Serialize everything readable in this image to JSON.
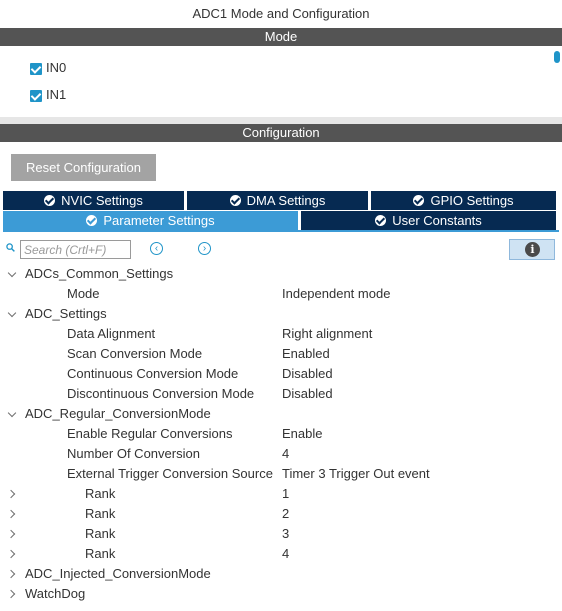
{
  "window": {
    "title": "ADC1 Mode and Configuration"
  },
  "mode": {
    "header": "Mode",
    "channels": [
      {
        "label": "IN0",
        "checked": true
      },
      {
        "label": "IN1",
        "checked": true
      }
    ]
  },
  "configuration": {
    "header": "Configuration",
    "reset_label": "Reset Configuration",
    "tabs": [
      {
        "label": "NVIC Settings",
        "active": false
      },
      {
        "label": "DMA Settings",
        "active": false
      },
      {
        "label": "GPIO Settings",
        "active": false
      },
      {
        "label": "Parameter Settings",
        "active": true
      },
      {
        "label": "User Constants",
        "active": false
      }
    ],
    "search": {
      "placeholder": "Search (Crtl+F)",
      "value": ""
    },
    "nav": {
      "prev": "‹",
      "next": "›"
    },
    "info": "i"
  },
  "tree": [
    {
      "label": "ADCs_Common_Settings",
      "value": "",
      "level": 0,
      "expander": "down"
    },
    {
      "label": "Mode",
      "value": "Independent mode",
      "level": 1,
      "expander": ""
    },
    {
      "label": "ADC_Settings",
      "value": "",
      "level": 0,
      "expander": "down"
    },
    {
      "label": "Data Alignment",
      "value": "Right alignment",
      "level": 1,
      "expander": ""
    },
    {
      "label": "Scan Conversion Mode",
      "value": "Enabled",
      "level": 1,
      "expander": ""
    },
    {
      "label": "Continuous Conversion Mode",
      "value": "Disabled",
      "level": 1,
      "expander": ""
    },
    {
      "label": "Discontinuous Conversion Mode",
      "value": "Disabled",
      "level": 1,
      "expander": ""
    },
    {
      "label": "ADC_Regular_ConversionMode",
      "value": "",
      "level": 0,
      "expander": "down"
    },
    {
      "label": "Enable Regular Conversions",
      "value": "Enable",
      "level": 1,
      "expander": ""
    },
    {
      "label": "Number Of Conversion",
      "value": "4",
      "level": 1,
      "expander": ""
    },
    {
      "label": "External Trigger Conversion Source",
      "value": "Timer 3 Trigger Out event",
      "level": 1,
      "expander": ""
    },
    {
      "label": "Rank",
      "value": "1",
      "level": 2,
      "expander": "right"
    },
    {
      "label": "Rank",
      "value": "2",
      "level": 2,
      "expander": "right"
    },
    {
      "label": "Rank",
      "value": "3",
      "level": 2,
      "expander": "right"
    },
    {
      "label": "Rank",
      "value": "4",
      "level": 2,
      "expander": "right"
    },
    {
      "label": "ADC_Injected_ConversionMode",
      "value": "",
      "level": 0,
      "expander": "right"
    },
    {
      "label": "WatchDog",
      "value": "",
      "level": 0,
      "expander": "right"
    }
  ]
}
